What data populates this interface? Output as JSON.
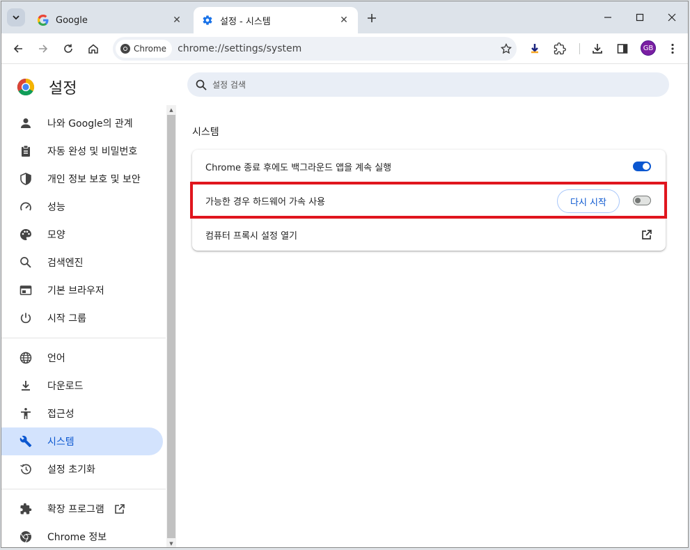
{
  "tabs": [
    {
      "title": "Google",
      "icon": "google-icon"
    },
    {
      "title": "설정 - 시스템",
      "icon": "gear-icon"
    }
  ],
  "toolbar": {
    "chip_label": "Chrome",
    "url": "chrome://settings/system",
    "avatar_initials": "GB"
  },
  "settings": {
    "title": "설정",
    "search_placeholder": "설정 검색",
    "nav_items": [
      {
        "label": "나와 Google의 관계",
        "icon": "person-icon"
      },
      {
        "label": "자동 완성 및 비밀번호",
        "icon": "clipboard-icon"
      },
      {
        "label": "개인 정보 보호 및 보안",
        "icon": "shield-icon"
      },
      {
        "label": "성능",
        "icon": "speedometer-icon"
      },
      {
        "label": "모양",
        "icon": "palette-icon"
      },
      {
        "label": "검색엔진",
        "icon": "search-icon"
      },
      {
        "label": "기본 브라우저",
        "icon": "browser-icon"
      },
      {
        "label": "시작 그룹",
        "icon": "power-icon"
      },
      {
        "label": "언어",
        "icon": "globe-icon"
      },
      {
        "label": "다운로드",
        "icon": "download-icon"
      },
      {
        "label": "접근성",
        "icon": "accessibility-icon"
      },
      {
        "label": "시스템",
        "icon": "wrench-icon"
      },
      {
        "label": "설정 초기화",
        "icon": "history-icon"
      },
      {
        "label": "확장 프로그램",
        "icon": "puzzle-icon"
      },
      {
        "label": "Chrome 정보",
        "icon": "chrome-icon"
      }
    ],
    "selected_nav": "시스템",
    "section_title": "시스템",
    "rows": [
      {
        "label": "Chrome 종료 후에도 백그라운드 앱을 계속 실행",
        "toggle": true
      },
      {
        "label": "가능한 경우 하드웨어 가속 사용",
        "toggle": false,
        "button": "다시 시작"
      },
      {
        "label": "컴퓨터 프록시 설정 열기",
        "icon": "open-external-icon"
      }
    ]
  },
  "colors": {
    "accent": "#0b57d0",
    "selected_bg": "#d3e3fd",
    "highlight": "#e0161e"
  }
}
